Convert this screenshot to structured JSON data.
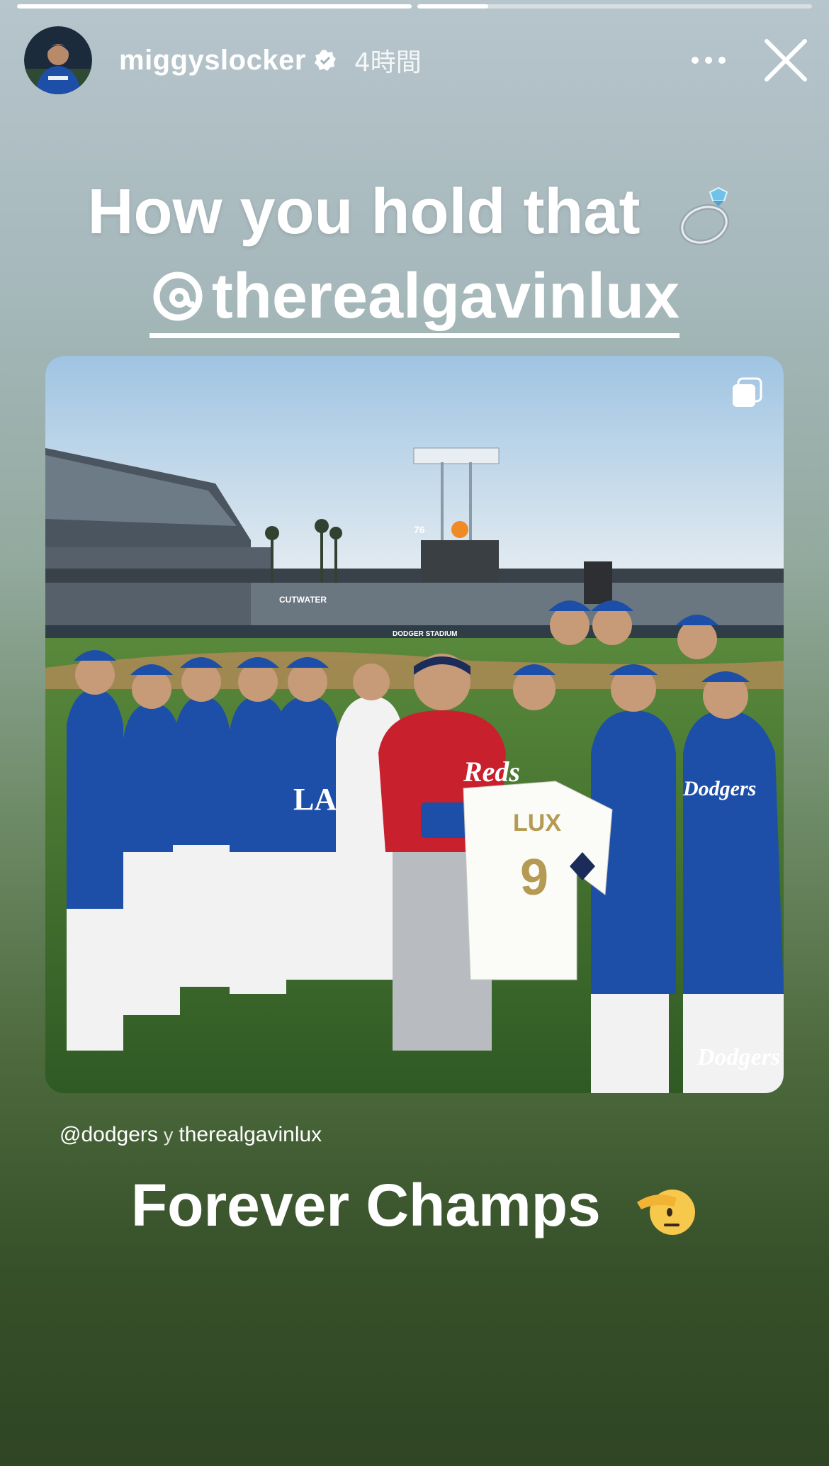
{
  "story": {
    "progress": [
      1.0,
      0.2
    ],
    "username": "miggyslocker",
    "verified": true,
    "time": "4時間",
    "caption_line1": "How you hold that",
    "caption_line1_emoji": "ring",
    "mention": "therealgavinlux",
    "caption_line2": "Forever Champs",
    "caption_line2_emoji": "saluting-face"
  },
  "post": {
    "credit_user": "@dodgers",
    "credit_joiner": "y",
    "credit_coauthor": "therealgavinlux",
    "photo_texts": {
      "jersey_name": "LUX",
      "jersey_number": "9",
      "red_jersey": "Reds",
      "team_wordmark": "Dodgers",
      "cap_logo": "LA",
      "scoreboard_badge": "76",
      "sign_1": "CUTWATER",
      "sign_2": "DODGER STADIUM"
    }
  },
  "colors": {
    "dodger_blue": "#1e4fa8",
    "reds_red": "#c8202d",
    "grass": "#3e6e30"
  },
  "icons": {
    "more": "more-horizontal-icon",
    "close": "close-icon",
    "multi": "carousel-icon",
    "verified": "verified-badge-icon",
    "threads": "threads-icon"
  }
}
